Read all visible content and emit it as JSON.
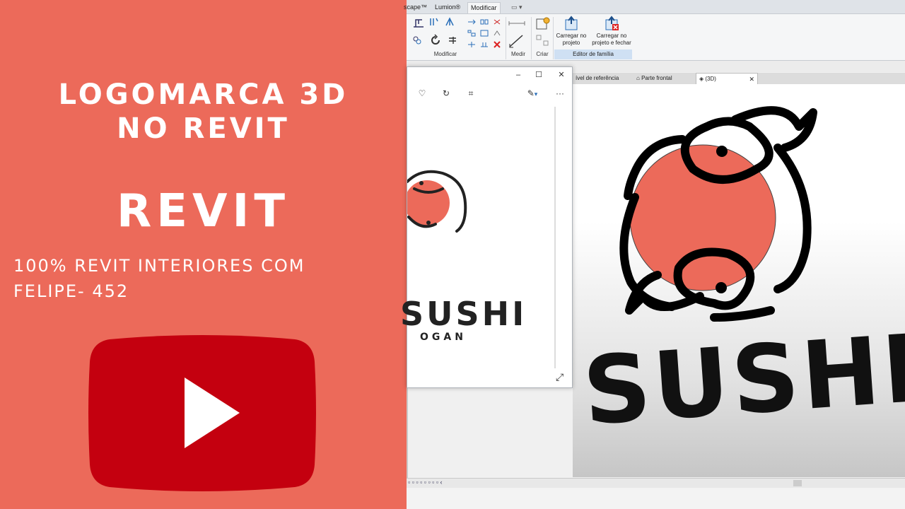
{
  "promo": {
    "title_line1": "LOGOMARCA 3D",
    "title_line2": "NO REVIT",
    "headline": "REVIT",
    "subtitle_line1": "100% REVIT INTERIORES COM",
    "subtitle_line2": "FELIPE- 452",
    "play_icon": "youtube-play-icon",
    "colors": {
      "background": "#ec6a5a",
      "youtube_red": "#c4000f"
    }
  },
  "revit": {
    "ribbon_tabs": [
      "scape™",
      "Lumion®",
      "Modificar"
    ],
    "active_tab": "Modificar",
    "groups": {
      "modify_label": "Modificar",
      "measure_label": "Medir",
      "create_label": "Criar",
      "family_editor_label": "Editor de família"
    },
    "buttons": {
      "load_into_project": "Carregar no projeto",
      "load_into_project_l1": "Carregar no",
      "load_into_project_l2": "projeto",
      "load_and_close_l1": "Carregar no",
      "load_and_close_l2": "projeto e fechar"
    },
    "view_tabs": [
      {
        "label": "ível de referência",
        "icon": "level-icon"
      },
      {
        "label": "Parte frontal",
        "icon": "elevation-icon"
      },
      {
        "label": "(3D)",
        "icon": "3d-view-icon",
        "active": true
      }
    ],
    "view_tab_close": "✕",
    "model_text": "SUSHI",
    "logo_color": "#ec6a5a"
  },
  "viewer": {
    "window_buttons": {
      "minimize": "–",
      "maximize": "☐",
      "close": "✕"
    },
    "tools": [
      "heart-icon",
      "rotate-icon",
      "crop-icon",
      "edit-icon",
      "more-icon"
    ],
    "more": "···",
    "logo_text": "SUSHI",
    "slogan_text": "OGAN",
    "expand_icon": "expand-icon"
  }
}
